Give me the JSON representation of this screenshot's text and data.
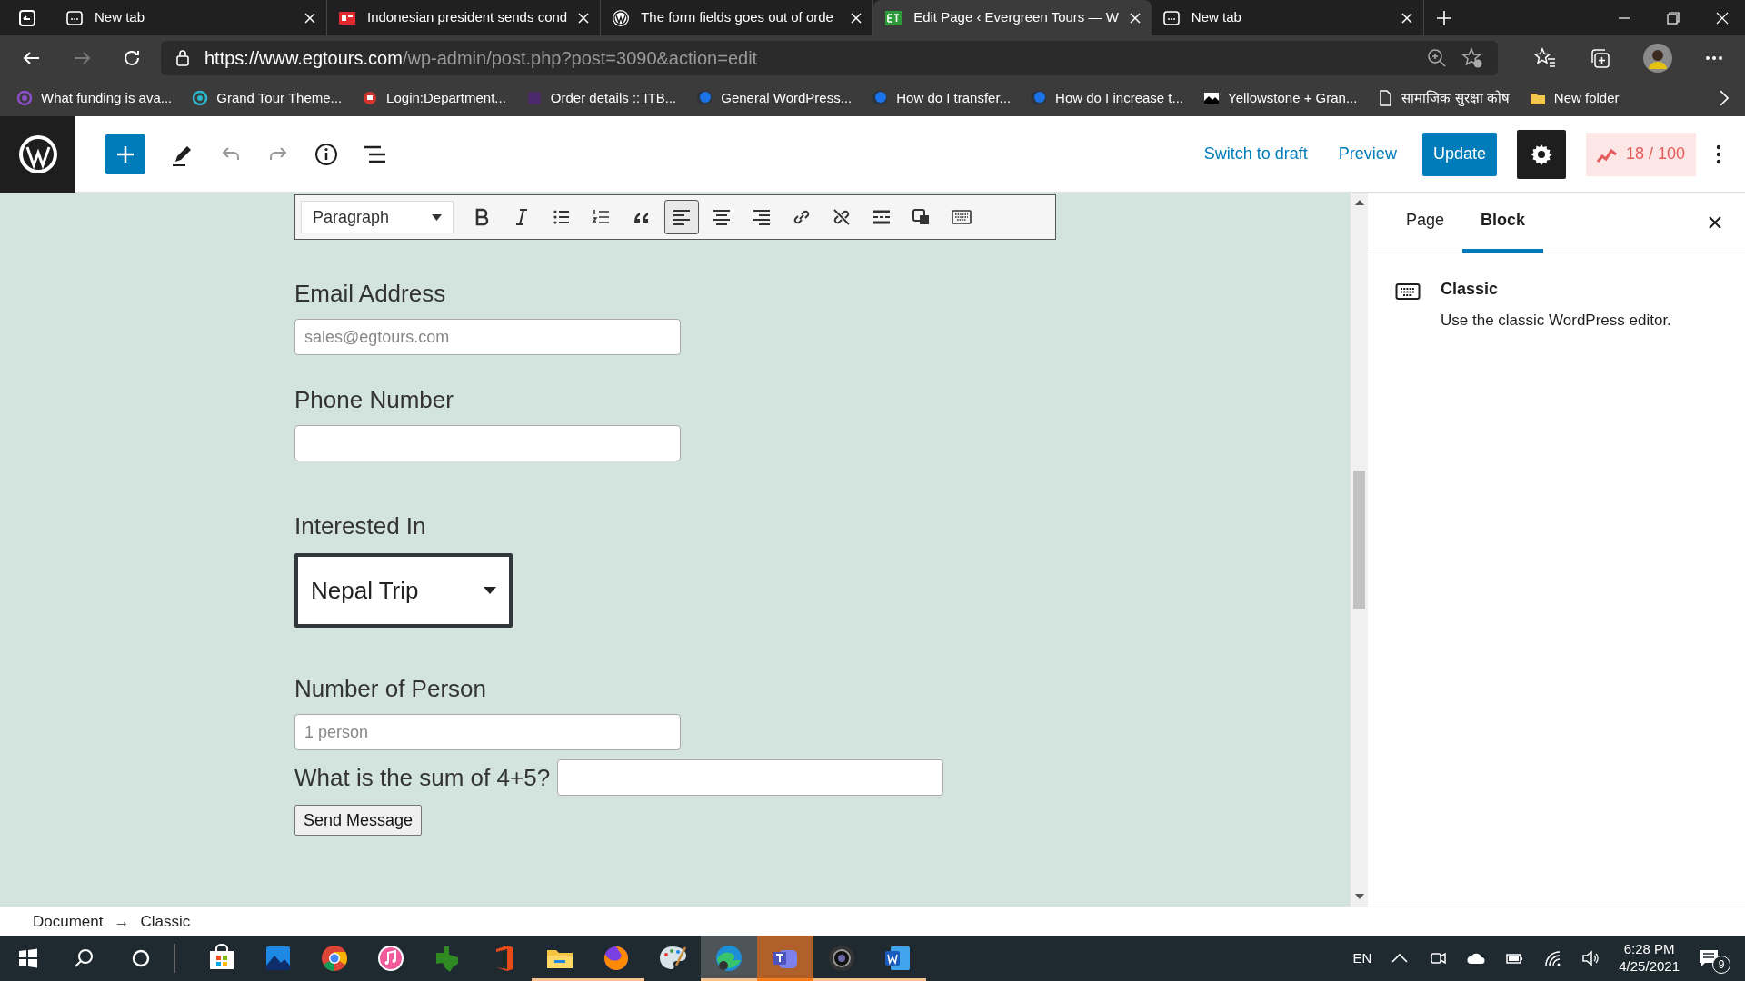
{
  "browser": {
    "tabs": [
      {
        "title": "New tab",
        "kind": "newtab",
        "selected": false
      },
      {
        "title": "Indonesian president sends cond",
        "kind": "news",
        "selected": false
      },
      {
        "title": "The form fields goes out of orde",
        "kind": "wordpress",
        "selected": false
      },
      {
        "title": "Edit Page ‹ Evergreen Tours — W",
        "kind": "site",
        "selected": true
      },
      {
        "title": "New tab",
        "kind": "newtab",
        "selected": false
      }
    ],
    "address": {
      "host": "https://www.egtours.com",
      "path": "/wp-admin/post.php?post=3090&action=edit"
    },
    "bookmarks": [
      {
        "label": "What funding is ava...",
        "kind": "ring"
      },
      {
        "label": "Grand Tour Theme...",
        "kind": "ring"
      },
      {
        "label": "Login:Department...",
        "kind": "emblem"
      },
      {
        "label": "Order details :: ITB...",
        "kind": "square"
      },
      {
        "label": "General WordPress...",
        "kind": "dot"
      },
      {
        "label": "How do I transfer...",
        "kind": "dot"
      },
      {
        "label": "How do I increase t...",
        "kind": "dot"
      },
      {
        "label": "Yellowstone + Gran...",
        "kind": "image"
      },
      {
        "label": "सामाजिक सुरक्षा कोष",
        "kind": "page"
      },
      {
        "label": "New folder",
        "kind": "folder"
      }
    ]
  },
  "wp_header": {
    "switch_to_draft": "Switch to draft",
    "preview": "Preview",
    "update": "Update",
    "score": "18 / 100"
  },
  "classic_toolbar": {
    "format": "Paragraph",
    "tools": [
      {
        "kind": "bold",
        "selected": false
      },
      {
        "kind": "italic",
        "selected": false
      },
      {
        "kind": "bullets",
        "selected": false
      },
      {
        "kind": "numbers",
        "selected": false
      },
      {
        "kind": "quote",
        "selected": false
      },
      {
        "kind": "align-left",
        "selected": true
      },
      {
        "kind": "align-center",
        "selected": false
      },
      {
        "kind": "align-right",
        "selected": false
      },
      {
        "kind": "link",
        "selected": false
      },
      {
        "kind": "unlink",
        "selected": false
      },
      {
        "kind": "more",
        "selected": false
      },
      {
        "kind": "media",
        "selected": false
      },
      {
        "kind": "keyboard",
        "selected": false
      }
    ]
  },
  "form": {
    "fields": [
      {
        "label": "Email Address",
        "kind": "text",
        "placeholder": "sales@egtours.com"
      },
      {
        "label": "Phone Number",
        "kind": "text"
      },
      {
        "label": "Interested In",
        "kind": "select",
        "value": "Nepal Trip"
      },
      {
        "label": "Number of Person",
        "kind": "text",
        "placeholder": "1 person"
      },
      {
        "label": "What is the sum of 4+5?",
        "kind": "inline"
      }
    ],
    "submit": "Send Message"
  },
  "sidebar": {
    "tabs": [
      {
        "label": "Page",
        "selected": false
      },
      {
        "label": "Block",
        "selected": true
      }
    ],
    "block": {
      "title": "Classic",
      "description": "Use the classic WordPress editor."
    }
  },
  "breadcrumb": {
    "items": [
      "Document",
      "Classic"
    ],
    "separator": "→"
  },
  "taskbar": {
    "apps": [
      {
        "kind": "store",
        "running": false,
        "selected": false,
        "highlighted": false
      },
      {
        "kind": "photos",
        "running": false,
        "selected": false,
        "highlighted": false
      },
      {
        "kind": "chrome",
        "running": false,
        "selected": false,
        "highlighted": false
      },
      {
        "kind": "itunes",
        "running": false,
        "selected": false,
        "highlighted": false
      },
      {
        "kind": "texas",
        "running": false,
        "selected": false,
        "highlighted": false
      },
      {
        "kind": "office",
        "running": false,
        "selected": false,
        "highlighted": false
      },
      {
        "kind": "explorer",
        "running": true,
        "selected": false,
        "highlighted": false
      },
      {
        "kind": "firefox",
        "running": true,
        "selected": false,
        "highlighted": false
      },
      {
        "kind": "paint",
        "running": false,
        "selected": false,
        "highlighted": false
      },
      {
        "kind": "edge",
        "running": true,
        "selected": true,
        "highlighted": false
      },
      {
        "kind": "teams",
        "running": true,
        "selected": false,
        "highlighted": true
      },
      {
        "kind": "camera",
        "running": true,
        "selected": false,
        "highlighted": false
      },
      {
        "kind": "word",
        "running": true,
        "selected": false,
        "highlighted": false
      }
    ],
    "language": "EN",
    "time": "6:28 PM",
    "date": "4/25/2021",
    "notifications": "9"
  }
}
